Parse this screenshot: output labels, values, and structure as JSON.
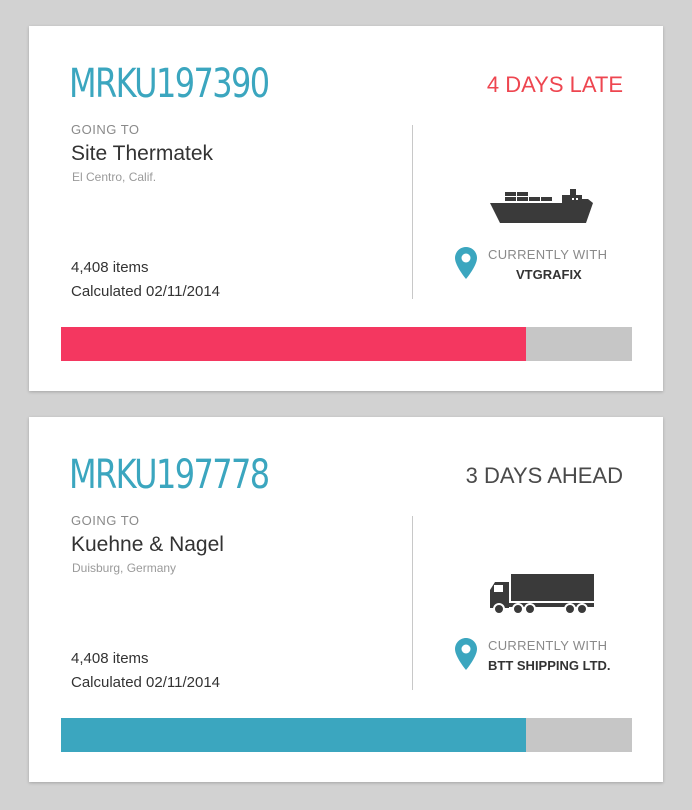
{
  "shipments": [
    {
      "tracking_id": "MRKU197390",
      "status": "4 DAYS LATE",
      "status_color": "#ee4650",
      "going_to_label": "GOING TO",
      "destination_name": "Site Thermatek",
      "destination_city": "El Centro, Calif.",
      "items": "4,408 items",
      "calculated": "Calculated 02/11/2014",
      "vehicle_icon": "cargo-ship-icon",
      "currently_with_label": "CURRENTLY WITH",
      "carrier": "VTGRAFIX",
      "progress": 0.815,
      "progress_color": "#f43760"
    },
    {
      "tracking_id": "MRKU197778",
      "status": "3 DAYS AHEAD",
      "status_color": "#4a4a4a",
      "going_to_label": "GOING TO",
      "destination_name": "Kuehne & Nagel",
      "destination_city": "Duisburg, Germany",
      "items": "4,408 items",
      "calculated": "Calculated 02/11/2014",
      "vehicle_icon": "truck-icon",
      "currently_with_label": "CURRENTLY WITH",
      "carrier": "BTT SHIPPING LTD.",
      "progress": 0.815,
      "progress_color": "#3ba6bf"
    }
  ],
  "colors": {
    "accent": "#3ba6bf",
    "late": "#ee4650",
    "track": "#c6c6c6",
    "background": "#d2d2d2"
  }
}
